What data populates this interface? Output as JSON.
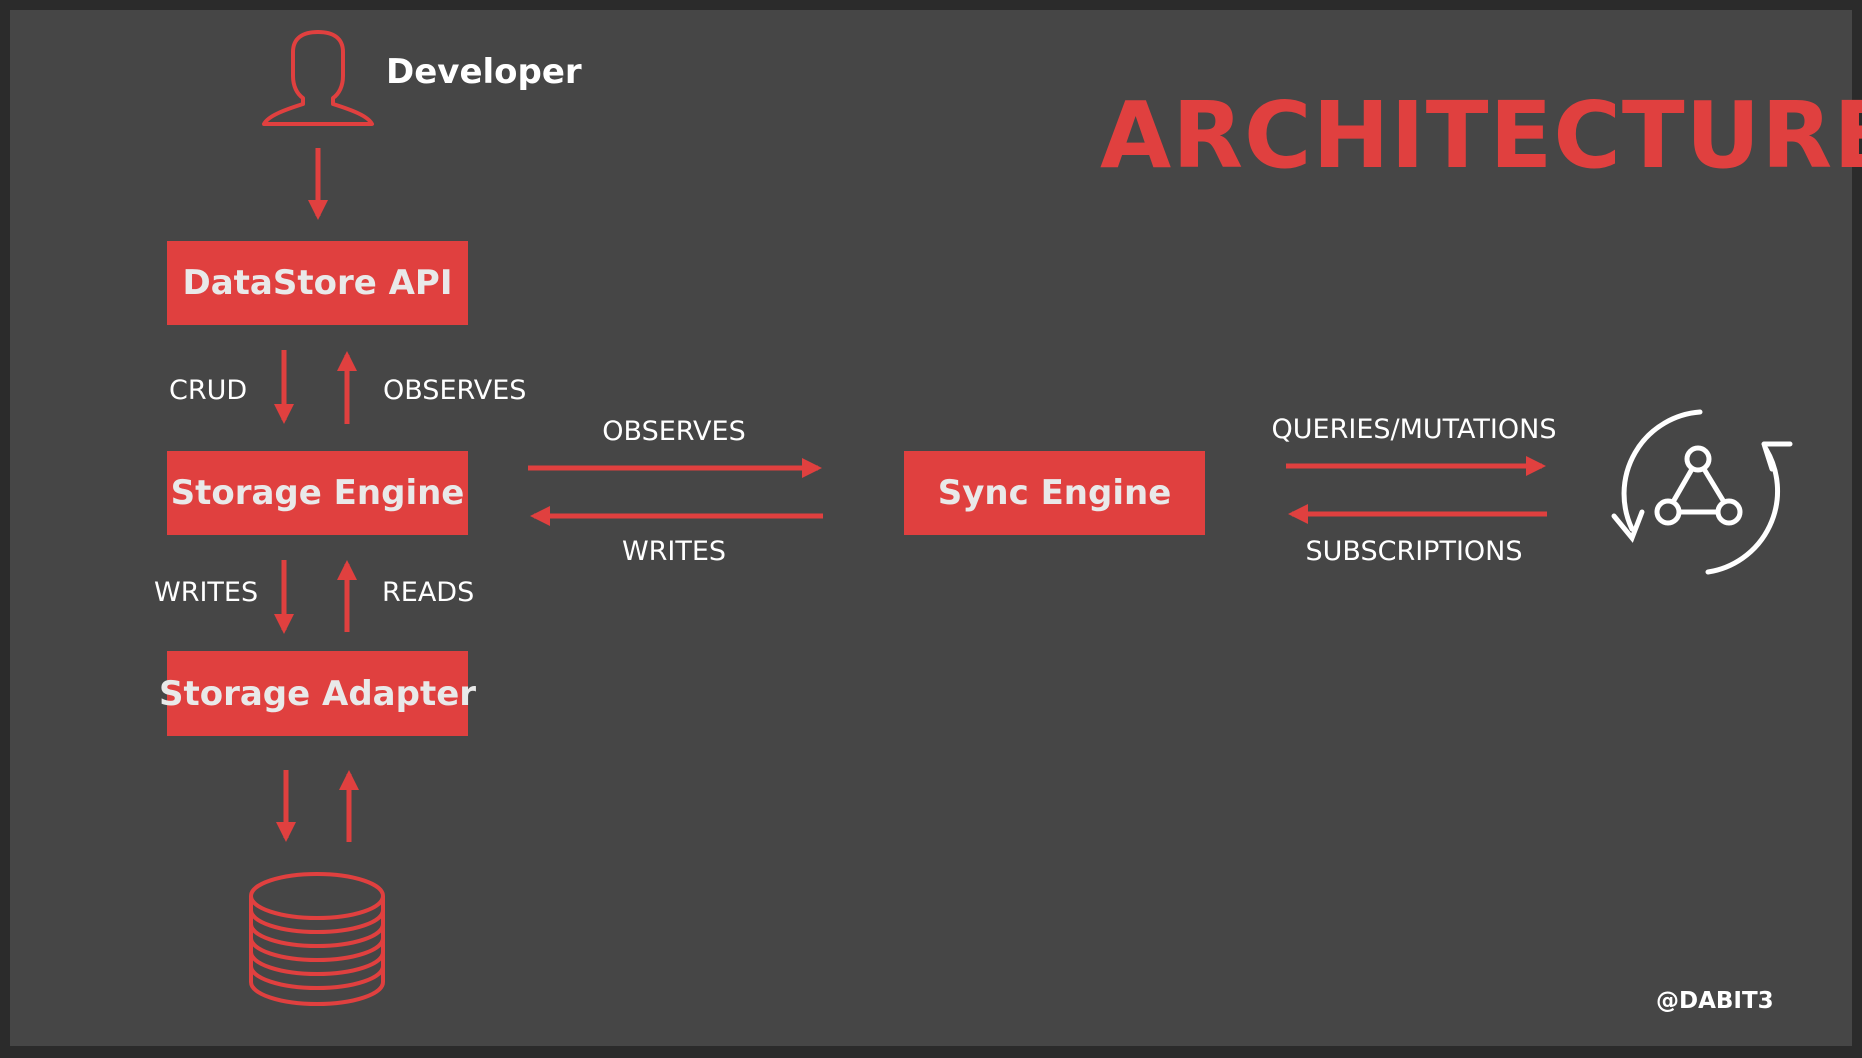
{
  "slide": {
    "title": "ARCHITECTURE",
    "credit": "@DABIT3",
    "accent_color": "#e0403f",
    "background_color": "#464646"
  },
  "nodes": {
    "developer": {
      "label": "Developer",
      "icon": "person-icon"
    },
    "datastore_api": {
      "label": "DataStore API"
    },
    "storage_engine": {
      "label": "Storage Engine"
    },
    "storage_adapter": {
      "label": "Storage Adapter"
    },
    "sync_engine": {
      "label": "Sync Engine"
    },
    "database": {
      "icon": "database-icon"
    },
    "cloud_sync": {
      "icon": "graphql-sync-icon"
    }
  },
  "edges": {
    "api_to_engine": "CRUD",
    "engine_to_api": "OBSERVES",
    "engine_to_adapter": "WRITES",
    "adapter_to_engine": "READS",
    "storage_to_sync": "OBSERVES",
    "sync_to_storage": "WRITES",
    "sync_to_cloud": "QUERIES/MUTATIONS",
    "cloud_to_sync": "SUBSCRIPTIONS"
  }
}
